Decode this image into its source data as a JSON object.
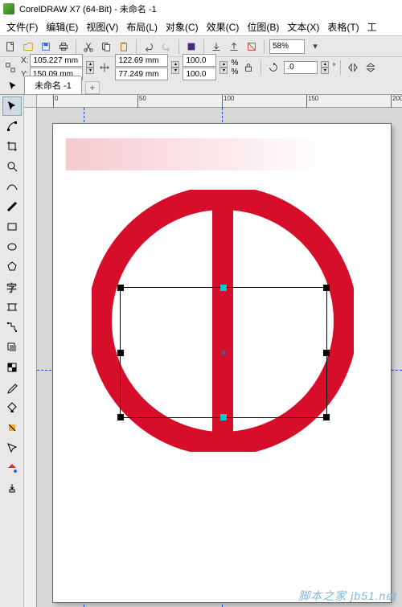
{
  "title": "CorelDRAW X7 (64-Bit) - 未命名 -1",
  "menu": {
    "file": "文件(F)",
    "edit": "编辑(E)",
    "view": "视图(V)",
    "layout": "布局(L)",
    "object": "对象(C)",
    "effects": "效果(C)",
    "bitmaps": "位图(B)",
    "text": "文本(X)",
    "tables": "表格(T)",
    "tools": "工"
  },
  "toolbar": {
    "zoom": "58%"
  },
  "props": {
    "x_label": "X:",
    "x": "105.227 mm",
    "y_label": "Y:",
    "y": "150.09 mm",
    "w": "122.69 mm",
    "h": "77.249 mm",
    "sx": "100.0",
    "sy": "100.0",
    "rotation": ".0"
  },
  "tab": {
    "name": "未命名 -1"
  },
  "ruler": {
    "h": [
      "0",
      "50",
      "100",
      "150",
      "200"
    ]
  },
  "watermark": "脚本之家  jb51.net"
}
